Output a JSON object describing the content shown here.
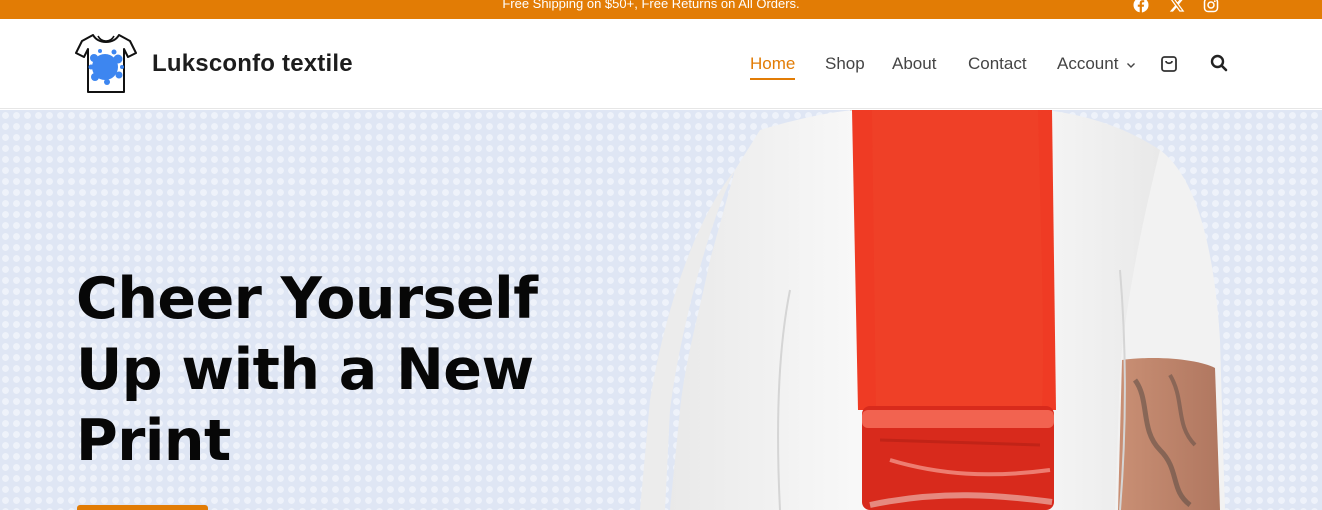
{
  "topbar": {
    "message": "Free Shipping on $50+, Free Returns on All Orders.",
    "background_color": "#e27c05",
    "social_icons": [
      "facebook-icon",
      "x-twitter-icon",
      "instagram-icon"
    ]
  },
  "header": {
    "brand_name": "Luksconfo textile",
    "logo_icon": "tshirt-paint-splash-logo",
    "nav": [
      {
        "label": "Home",
        "active": true
      },
      {
        "label": "Shop"
      },
      {
        "label": "About"
      },
      {
        "label": "Contact"
      },
      {
        "label": "Account",
        "has_dropdown": true
      }
    ],
    "icons": [
      "cart-icon",
      "search-icon"
    ],
    "accent_color": "#e27c05"
  },
  "hero": {
    "title_line1": "Cheer Yourself",
    "title_line2": "Up with a New",
    "title_line3": "Print",
    "image": "man-in-white-tshirt-with-red-paint-roller-stripe"
  }
}
